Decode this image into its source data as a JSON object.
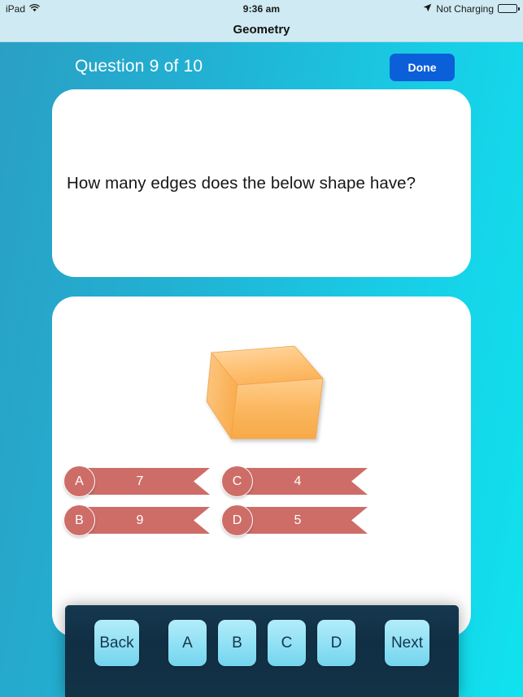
{
  "statusbar": {
    "device_label": "iPad",
    "wifi_icon": "wifi-icon",
    "time": "9:36 am",
    "location_icon": "location-arrow-icon",
    "charging_status": "Not Charging",
    "battery_icon": "battery-icon"
  },
  "navbar": {
    "title": "Geometry"
  },
  "quiz": {
    "counter": "Question 9 of 10",
    "done_label": "Done",
    "question_text": "How many edges does the below shape have?",
    "shape": {
      "name": "cube-3d-shape",
      "fill_light": "#ffd29a",
      "fill_mid": "#fbb85f",
      "fill_dark": "#f5a94d"
    },
    "answers": [
      {
        "key": "A",
        "value": "7"
      },
      {
        "key": "C",
        "value": "4"
      },
      {
        "key": "B",
        "value": "9"
      },
      {
        "key": "D",
        "value": "5"
      }
    ]
  },
  "toolbar": {
    "back_label": "Back",
    "choice_a": "A",
    "choice_b": "B",
    "choice_c": "C",
    "choice_d": "D",
    "next_label": "Next"
  },
  "colors": {
    "bg_gradient_start": "#2a9fc4",
    "bg_gradient_end": "#10e2ef",
    "navbar": "#cfeaf3",
    "done_button": "#0b5fd8",
    "ribbon": "#ce6d68",
    "toolbar_panel": "#123246",
    "toolbar_button": "#8fe0f5"
  }
}
